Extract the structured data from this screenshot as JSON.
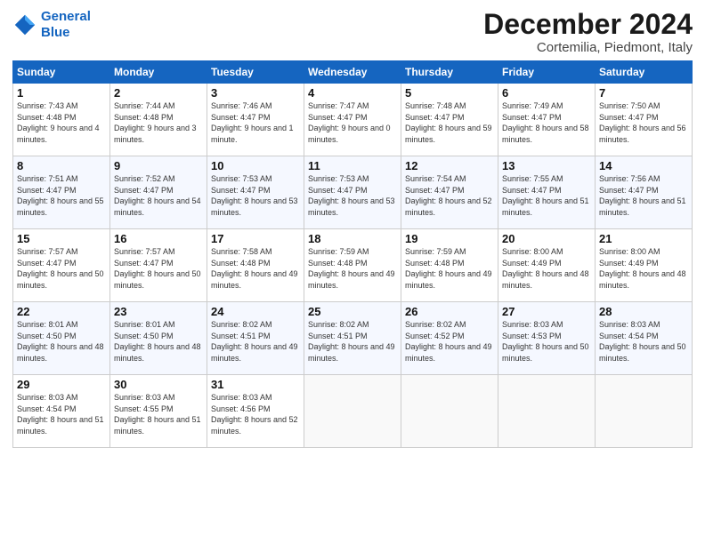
{
  "logo": {
    "line1": "General",
    "line2": "Blue"
  },
  "title": "December 2024",
  "subtitle": "Cortemilia, Piedmont, Italy",
  "days": [
    "Sunday",
    "Monday",
    "Tuesday",
    "Wednesday",
    "Thursday",
    "Friday",
    "Saturday"
  ],
  "weeks": [
    [
      {
        "day": "1",
        "sunrise": "7:43 AM",
        "sunset": "4:48 PM",
        "daylight": "9 hours and 4 minutes."
      },
      {
        "day": "2",
        "sunrise": "7:44 AM",
        "sunset": "4:48 PM",
        "daylight": "9 hours and 3 minutes."
      },
      {
        "day": "3",
        "sunrise": "7:46 AM",
        "sunset": "4:47 PM",
        "daylight": "9 hours and 1 minute."
      },
      {
        "day": "4",
        "sunrise": "7:47 AM",
        "sunset": "4:47 PM",
        "daylight": "9 hours and 0 minutes."
      },
      {
        "day": "5",
        "sunrise": "7:48 AM",
        "sunset": "4:47 PM",
        "daylight": "8 hours and 59 minutes."
      },
      {
        "day": "6",
        "sunrise": "7:49 AM",
        "sunset": "4:47 PM",
        "daylight": "8 hours and 58 minutes."
      },
      {
        "day": "7",
        "sunrise": "7:50 AM",
        "sunset": "4:47 PM",
        "daylight": "8 hours and 56 minutes."
      }
    ],
    [
      {
        "day": "8",
        "sunrise": "7:51 AM",
        "sunset": "4:47 PM",
        "daylight": "8 hours and 55 minutes."
      },
      {
        "day": "9",
        "sunrise": "7:52 AM",
        "sunset": "4:47 PM",
        "daylight": "8 hours and 54 minutes."
      },
      {
        "day": "10",
        "sunrise": "7:53 AM",
        "sunset": "4:47 PM",
        "daylight": "8 hours and 53 minutes."
      },
      {
        "day": "11",
        "sunrise": "7:53 AM",
        "sunset": "4:47 PM",
        "daylight": "8 hours and 53 minutes."
      },
      {
        "day": "12",
        "sunrise": "7:54 AM",
        "sunset": "4:47 PM",
        "daylight": "8 hours and 52 minutes."
      },
      {
        "day": "13",
        "sunrise": "7:55 AM",
        "sunset": "4:47 PM",
        "daylight": "8 hours and 51 minutes."
      },
      {
        "day": "14",
        "sunrise": "7:56 AM",
        "sunset": "4:47 PM",
        "daylight": "8 hours and 51 minutes."
      }
    ],
    [
      {
        "day": "15",
        "sunrise": "7:57 AM",
        "sunset": "4:47 PM",
        "daylight": "8 hours and 50 minutes."
      },
      {
        "day": "16",
        "sunrise": "7:57 AM",
        "sunset": "4:47 PM",
        "daylight": "8 hours and 50 minutes."
      },
      {
        "day": "17",
        "sunrise": "7:58 AM",
        "sunset": "4:48 PM",
        "daylight": "8 hours and 49 minutes."
      },
      {
        "day": "18",
        "sunrise": "7:59 AM",
        "sunset": "4:48 PM",
        "daylight": "8 hours and 49 minutes."
      },
      {
        "day": "19",
        "sunrise": "7:59 AM",
        "sunset": "4:48 PM",
        "daylight": "8 hours and 49 minutes."
      },
      {
        "day": "20",
        "sunrise": "8:00 AM",
        "sunset": "4:49 PM",
        "daylight": "8 hours and 48 minutes."
      },
      {
        "day": "21",
        "sunrise": "8:00 AM",
        "sunset": "4:49 PM",
        "daylight": "8 hours and 48 minutes."
      }
    ],
    [
      {
        "day": "22",
        "sunrise": "8:01 AM",
        "sunset": "4:50 PM",
        "daylight": "8 hours and 48 minutes."
      },
      {
        "day": "23",
        "sunrise": "8:01 AM",
        "sunset": "4:50 PM",
        "daylight": "8 hours and 48 minutes."
      },
      {
        "day": "24",
        "sunrise": "8:02 AM",
        "sunset": "4:51 PM",
        "daylight": "8 hours and 49 minutes."
      },
      {
        "day": "25",
        "sunrise": "8:02 AM",
        "sunset": "4:51 PM",
        "daylight": "8 hours and 49 minutes."
      },
      {
        "day": "26",
        "sunrise": "8:02 AM",
        "sunset": "4:52 PM",
        "daylight": "8 hours and 49 minutes."
      },
      {
        "day": "27",
        "sunrise": "8:03 AM",
        "sunset": "4:53 PM",
        "daylight": "8 hours and 50 minutes."
      },
      {
        "day": "28",
        "sunrise": "8:03 AM",
        "sunset": "4:54 PM",
        "daylight": "8 hours and 50 minutes."
      }
    ],
    [
      {
        "day": "29",
        "sunrise": "8:03 AM",
        "sunset": "4:54 PM",
        "daylight": "8 hours and 51 minutes."
      },
      {
        "day": "30",
        "sunrise": "8:03 AM",
        "sunset": "4:55 PM",
        "daylight": "8 hours and 51 minutes."
      },
      {
        "day": "31",
        "sunrise": "8:03 AM",
        "sunset": "4:56 PM",
        "daylight": "8 hours and 52 minutes."
      },
      null,
      null,
      null,
      null
    ]
  ]
}
